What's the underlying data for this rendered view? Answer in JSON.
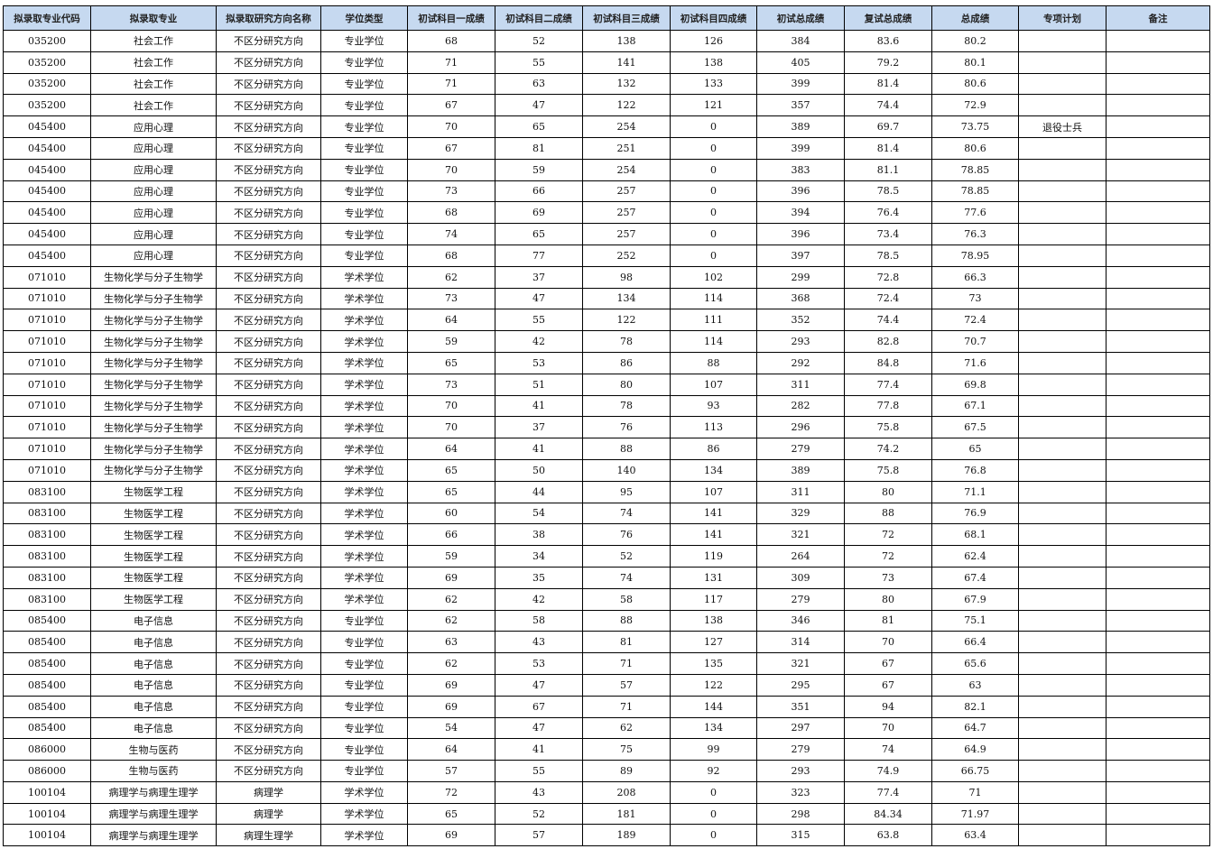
{
  "headers": [
    "拟录取专业代码",
    "拟录取专业",
    "拟录取研究方向名称",
    "学位类型",
    "初试科目一成绩",
    "初试科目二成绩",
    "初试科目三成绩",
    "初试科目四成绩",
    "初试总成绩",
    "复试总成绩",
    "总成绩",
    "专项计划",
    "备注"
  ],
  "rows": [
    [
      "035200",
      "社会工作",
      "不区分研究方向",
      "专业学位",
      "68",
      "52",
      "138",
      "126",
      "384",
      "83.6",
      "80.2",
      "",
      ""
    ],
    [
      "035200",
      "社会工作",
      "不区分研究方向",
      "专业学位",
      "71",
      "55",
      "141",
      "138",
      "405",
      "79.2",
      "80.1",
      "",
      ""
    ],
    [
      "035200",
      "社会工作",
      "不区分研究方向",
      "专业学位",
      "71",
      "63",
      "132",
      "133",
      "399",
      "81.4",
      "80.6",
      "",
      ""
    ],
    [
      "035200",
      "社会工作",
      "不区分研究方向",
      "专业学位",
      "67",
      "47",
      "122",
      "121",
      "357",
      "74.4",
      "72.9",
      "",
      ""
    ],
    [
      "045400",
      "应用心理",
      "不区分研究方向",
      "专业学位",
      "70",
      "65",
      "254",
      "0",
      "389",
      "69.7",
      "73.75",
      "退役士兵",
      ""
    ],
    [
      "045400",
      "应用心理",
      "不区分研究方向",
      "专业学位",
      "67",
      "81",
      "251",
      "0",
      "399",
      "81.4",
      "80.6",
      "",
      ""
    ],
    [
      "045400",
      "应用心理",
      "不区分研究方向",
      "专业学位",
      "70",
      "59",
      "254",
      "0",
      "383",
      "81.1",
      "78.85",
      "",
      ""
    ],
    [
      "045400",
      "应用心理",
      "不区分研究方向",
      "专业学位",
      "73",
      "66",
      "257",
      "0",
      "396",
      "78.5",
      "78.85",
      "",
      ""
    ],
    [
      "045400",
      "应用心理",
      "不区分研究方向",
      "专业学位",
      "68",
      "69",
      "257",
      "0",
      "394",
      "76.4",
      "77.6",
      "",
      ""
    ],
    [
      "045400",
      "应用心理",
      "不区分研究方向",
      "专业学位",
      "74",
      "65",
      "257",
      "0",
      "396",
      "73.4",
      "76.3",
      "",
      ""
    ],
    [
      "045400",
      "应用心理",
      "不区分研究方向",
      "专业学位",
      "68",
      "77",
      "252",
      "0",
      "397",
      "78.5",
      "78.95",
      "",
      ""
    ],
    [
      "071010",
      "生物化学与分子生物学",
      "不区分研究方向",
      "学术学位",
      "62",
      "37",
      "98",
      "102",
      "299",
      "72.8",
      "66.3",
      "",
      ""
    ],
    [
      "071010",
      "生物化学与分子生物学",
      "不区分研究方向",
      "学术学位",
      "73",
      "47",
      "134",
      "114",
      "368",
      "72.4",
      "73",
      "",
      ""
    ],
    [
      "071010",
      "生物化学与分子生物学",
      "不区分研究方向",
      "学术学位",
      "64",
      "55",
      "122",
      "111",
      "352",
      "74.4",
      "72.4",
      "",
      ""
    ],
    [
      "071010",
      "生物化学与分子生物学",
      "不区分研究方向",
      "学术学位",
      "59",
      "42",
      "78",
      "114",
      "293",
      "82.8",
      "70.7",
      "",
      ""
    ],
    [
      "071010",
      "生物化学与分子生物学",
      "不区分研究方向",
      "学术学位",
      "65",
      "53",
      "86",
      "88",
      "292",
      "84.8",
      "71.6",
      "",
      ""
    ],
    [
      "071010",
      "生物化学与分子生物学",
      "不区分研究方向",
      "学术学位",
      "73",
      "51",
      "80",
      "107",
      "311",
      "77.4",
      "69.8",
      "",
      ""
    ],
    [
      "071010",
      "生物化学与分子生物学",
      "不区分研究方向",
      "学术学位",
      "70",
      "41",
      "78",
      "93",
      "282",
      "77.8",
      "67.1",
      "",
      ""
    ],
    [
      "071010",
      "生物化学与分子生物学",
      "不区分研究方向",
      "学术学位",
      "70",
      "37",
      "76",
      "113",
      "296",
      "75.8",
      "67.5",
      "",
      ""
    ],
    [
      "071010",
      "生物化学与分子生物学",
      "不区分研究方向",
      "学术学位",
      "64",
      "41",
      "88",
      "86",
      "279",
      "74.2",
      "65",
      "",
      ""
    ],
    [
      "071010",
      "生物化学与分子生物学",
      "不区分研究方向",
      "学术学位",
      "65",
      "50",
      "140",
      "134",
      "389",
      "75.8",
      "76.8",
      "",
      ""
    ],
    [
      "083100",
      "生物医学工程",
      "不区分研究方向",
      "学术学位",
      "65",
      "44",
      "95",
      "107",
      "311",
      "80",
      "71.1",
      "",
      ""
    ],
    [
      "083100",
      "生物医学工程",
      "不区分研究方向",
      "学术学位",
      "60",
      "54",
      "74",
      "141",
      "329",
      "88",
      "76.9",
      "",
      ""
    ],
    [
      "083100",
      "生物医学工程",
      "不区分研究方向",
      "学术学位",
      "66",
      "38",
      "76",
      "141",
      "321",
      "72",
      "68.1",
      "",
      ""
    ],
    [
      "083100",
      "生物医学工程",
      "不区分研究方向",
      "学术学位",
      "59",
      "34",
      "52",
      "119",
      "264",
      "72",
      "62.4",
      "",
      ""
    ],
    [
      "083100",
      "生物医学工程",
      "不区分研究方向",
      "学术学位",
      "69",
      "35",
      "74",
      "131",
      "309",
      "73",
      "67.4",
      "",
      ""
    ],
    [
      "083100",
      "生物医学工程",
      "不区分研究方向",
      "学术学位",
      "62",
      "42",
      "58",
      "117",
      "279",
      "80",
      "67.9",
      "",
      ""
    ],
    [
      "085400",
      "电子信息",
      "不区分研究方向",
      "专业学位",
      "62",
      "58",
      "88",
      "138",
      "346",
      "81",
      "75.1",
      "",
      ""
    ],
    [
      "085400",
      "电子信息",
      "不区分研究方向",
      "专业学位",
      "63",
      "43",
      "81",
      "127",
      "314",
      "70",
      "66.4",
      "",
      ""
    ],
    [
      "085400",
      "电子信息",
      "不区分研究方向",
      "专业学位",
      "62",
      "53",
      "71",
      "135",
      "321",
      "67",
      "65.6",
      "",
      ""
    ],
    [
      "085400",
      "电子信息",
      "不区分研究方向",
      "专业学位",
      "69",
      "47",
      "57",
      "122",
      "295",
      "67",
      "63",
      "",
      ""
    ],
    [
      "085400",
      "电子信息",
      "不区分研究方向",
      "专业学位",
      "69",
      "67",
      "71",
      "144",
      "351",
      "94",
      "82.1",
      "",
      ""
    ],
    [
      "085400",
      "电子信息",
      "不区分研究方向",
      "专业学位",
      "54",
      "47",
      "62",
      "134",
      "297",
      "70",
      "64.7",
      "",
      ""
    ],
    [
      "086000",
      "生物与医药",
      "不区分研究方向",
      "专业学位",
      "64",
      "41",
      "75",
      "99",
      "279",
      "74",
      "64.9",
      "",
      ""
    ],
    [
      "086000",
      "生物与医药",
      "不区分研究方向",
      "专业学位",
      "57",
      "55",
      "89",
      "92",
      "293",
      "74.9",
      "66.75",
      "",
      ""
    ],
    [
      "100104",
      "病理学与病理生理学",
      "病理学",
      "学术学位",
      "72",
      "43",
      "208",
      "0",
      "323",
      "77.4",
      "71",
      "",
      ""
    ],
    [
      "100104",
      "病理学与病理生理学",
      "病理学",
      "学术学位",
      "65",
      "52",
      "181",
      "0",
      "298",
      "84.34",
      "71.97",
      "",
      ""
    ],
    [
      "100104",
      "病理学与病理生理学",
      "病理生理学",
      "学术学位",
      "69",
      "57",
      "189",
      "0",
      "315",
      "63.8",
      "63.4",
      "",
      ""
    ]
  ]
}
